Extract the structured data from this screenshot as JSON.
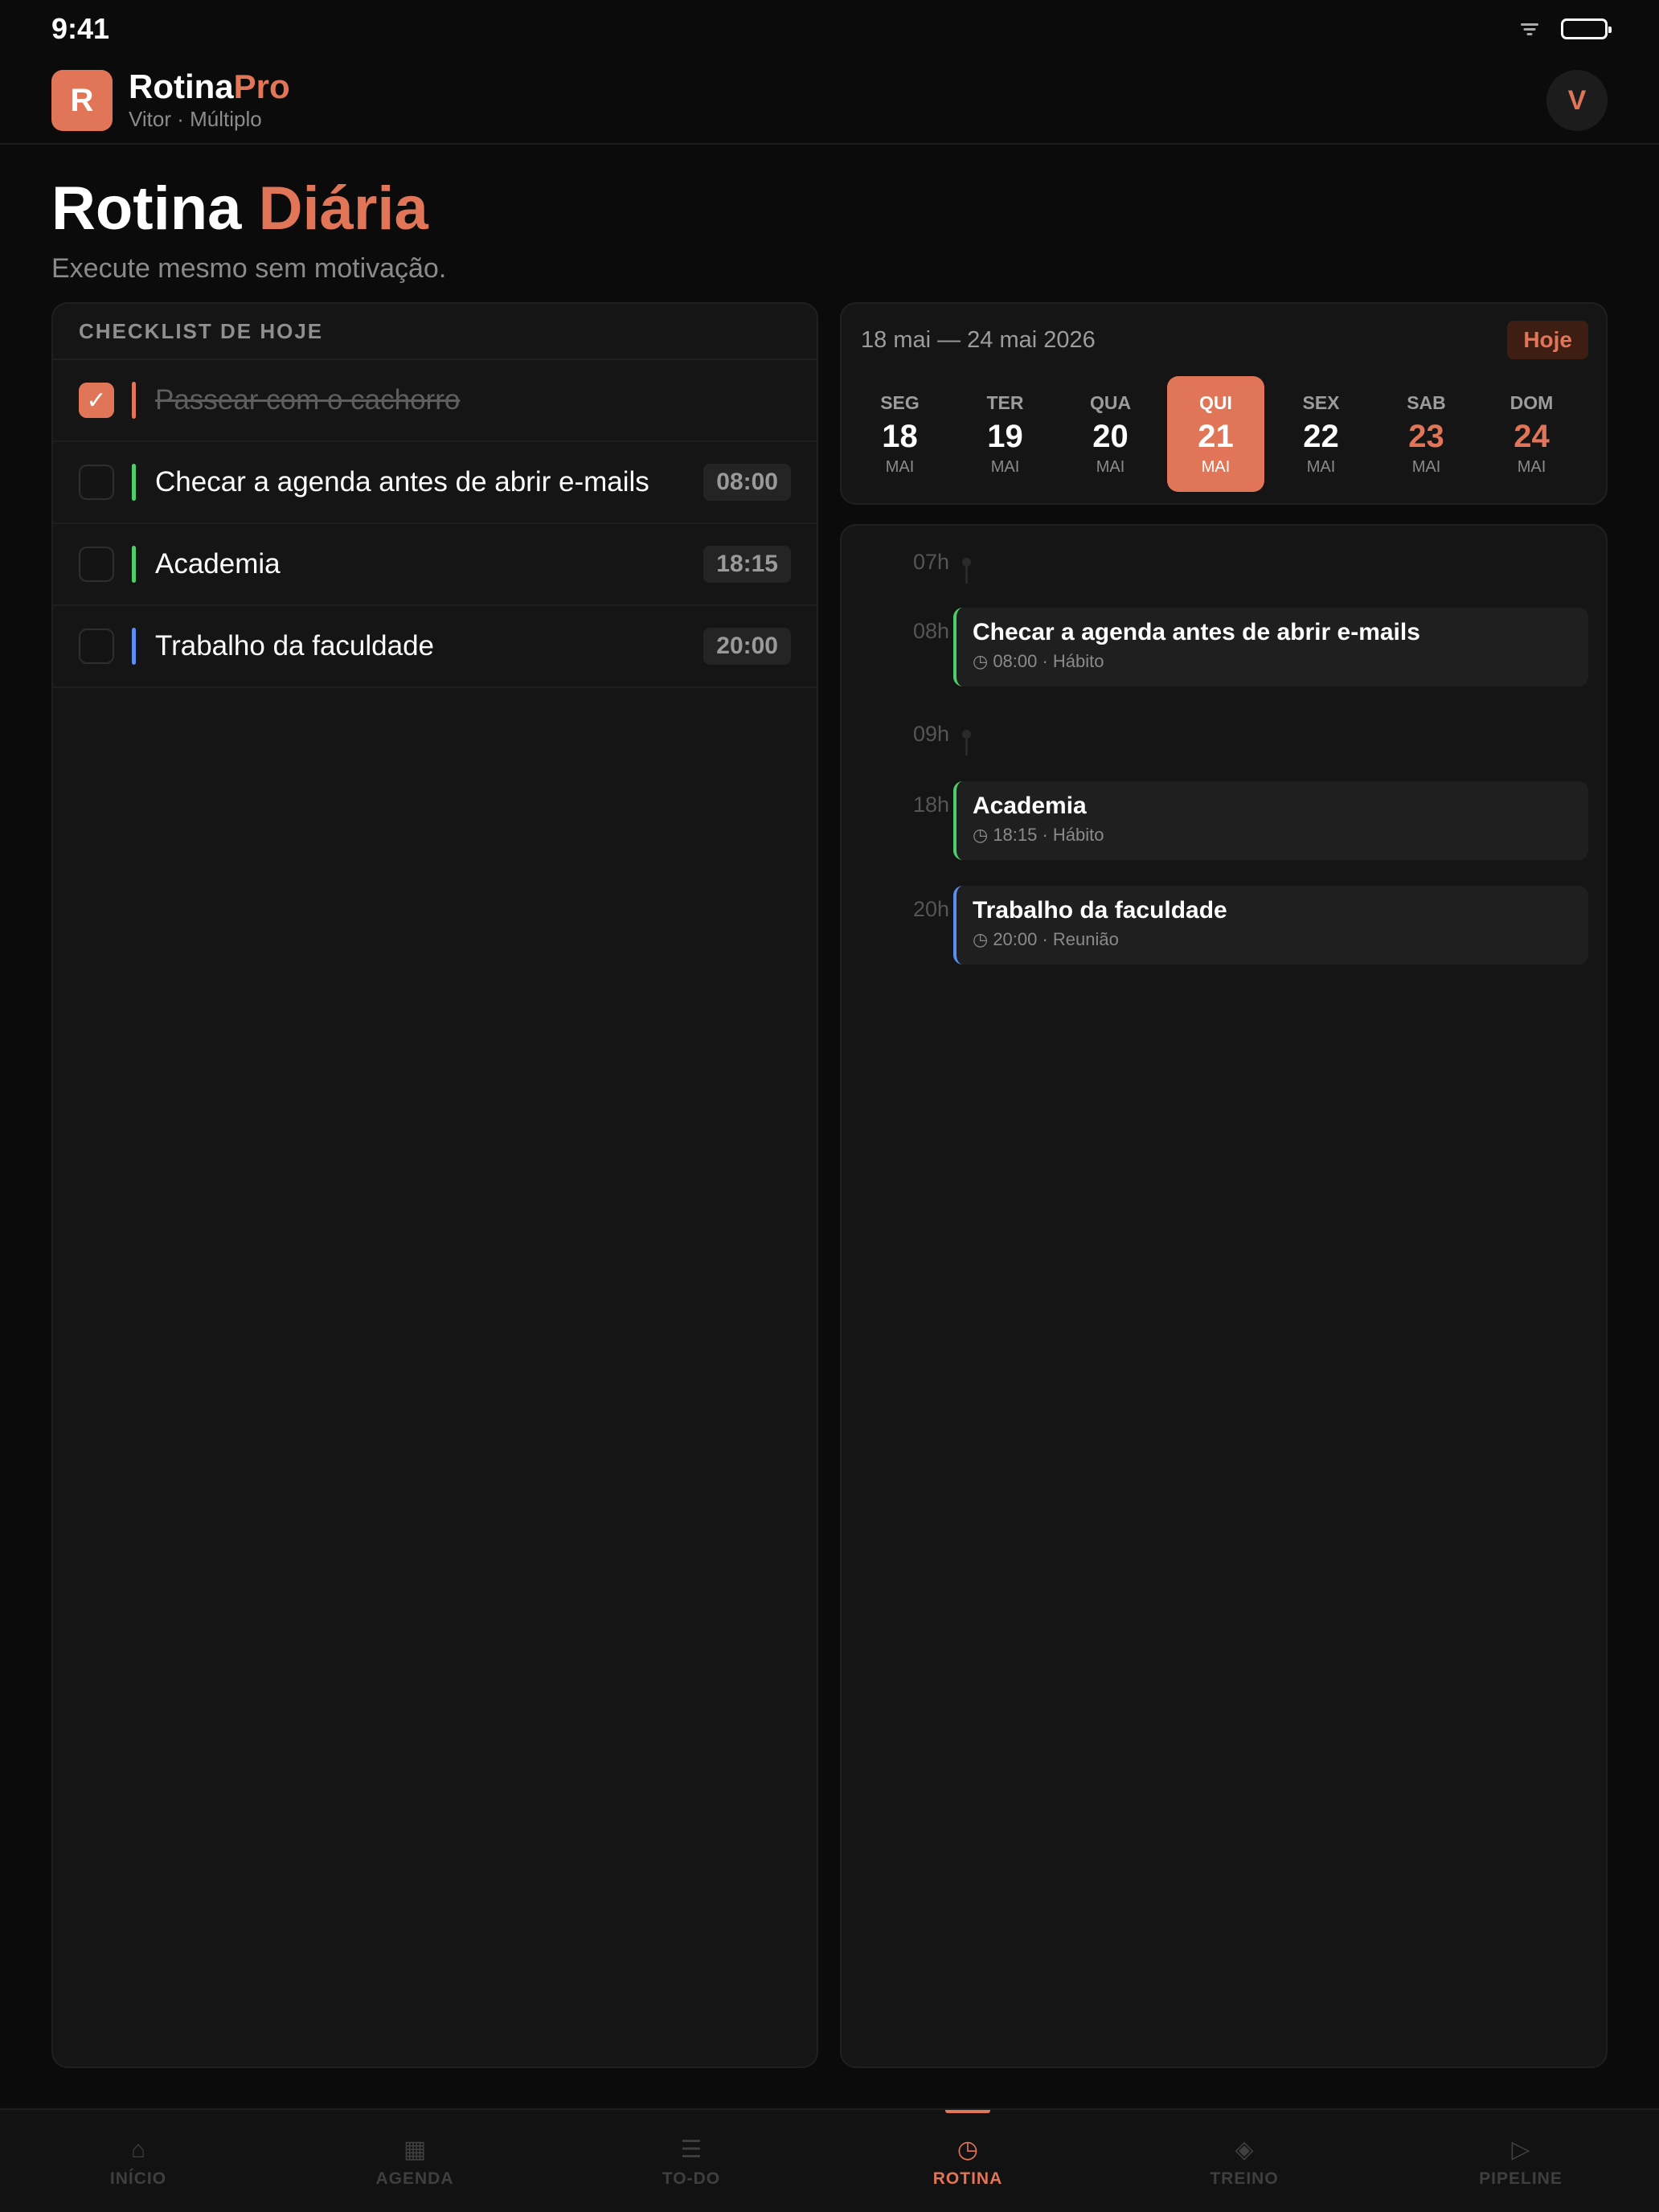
{
  "status": {
    "time": "9:41"
  },
  "header": {
    "logo_letter": "R",
    "brand_primary": "Rotina",
    "brand_accent": "Pro",
    "subtitle": "Vitor · Múltiplo",
    "avatar_letter": "V"
  },
  "page": {
    "title_main": "Rotina",
    "title_accent": "Diária",
    "subtitle": "Execute mesmo sem motivação."
  },
  "checklist": {
    "header": "CHECKLIST DE HOJE",
    "items": [
      {
        "label": "Passear com o cachorro",
        "time": "",
        "done": true,
        "color": "#e07558"
      },
      {
        "label": "Checar a agenda antes de abrir e-mails",
        "time": "08:00",
        "done": false,
        "color": "#4ccf6a"
      },
      {
        "label": "Academia",
        "time": "18:15",
        "done": false,
        "color": "#4ccf6a"
      },
      {
        "label": "Trabalho da faculdade",
        "time": "20:00",
        "done": false,
        "color": "#5b8ef0"
      }
    ]
  },
  "week": {
    "range": "18 mai — 24 mai 2026",
    "today_label": "Hoje",
    "days": [
      {
        "name": "SEG",
        "num": "18",
        "month": "MAI",
        "active": false,
        "weekend": false
      },
      {
        "name": "TER",
        "num": "19",
        "month": "MAI",
        "active": false,
        "weekend": false
      },
      {
        "name": "QUA",
        "num": "20",
        "month": "MAI",
        "active": false,
        "weekend": false
      },
      {
        "name": "QUI",
        "num": "21",
        "month": "MAI",
        "active": true,
        "weekend": false
      },
      {
        "name": "SEX",
        "num": "22",
        "month": "MAI",
        "active": false,
        "weekend": false
      },
      {
        "name": "SAB",
        "num": "23",
        "month": "MAI",
        "active": false,
        "weekend": true
      },
      {
        "name": "DOM",
        "num": "24",
        "month": "MAI",
        "active": false,
        "weekend": true
      }
    ]
  },
  "timeline": {
    "rows": [
      {
        "hour": "07h",
        "dot_color": "#2a2a2a",
        "event": null
      },
      {
        "hour": "08h",
        "dot_color": "#4ccf6a",
        "event": {
          "title": "Checar a agenda antes de abrir e-mails",
          "meta": "08:00 · Hábito",
          "color": "#4ccf6a"
        }
      },
      {
        "hour": "09h",
        "dot_color": "#2a2a2a",
        "event": null
      },
      {
        "hour": "18h",
        "dot_color": "#4ccf6a",
        "event": {
          "title": "Academia",
          "meta": "18:15 · Hábito",
          "color": "#4ccf6a"
        }
      },
      {
        "hour": "20h",
        "dot_color": "#5b8ef0",
        "event": {
          "title": "Trabalho da faculdade",
          "meta": "20:00 · Reunião",
          "color": "#5b8ef0"
        }
      }
    ]
  },
  "tabs": [
    {
      "label": "INÍCIO",
      "icon": "home-icon",
      "glyph": "⌂",
      "active": false
    },
    {
      "label": "AGENDA",
      "icon": "calendar-icon",
      "glyph": "▦",
      "active": false
    },
    {
      "label": "TO-DO",
      "icon": "list-icon",
      "glyph": "☰",
      "active": false
    },
    {
      "label": "ROTINA",
      "icon": "clock-icon",
      "glyph": "◷",
      "active": true
    },
    {
      "label": "TREINO",
      "icon": "diamond-icon",
      "glyph": "◈",
      "active": false
    },
    {
      "label": "PIPELINE",
      "icon": "play-icon",
      "glyph": "▷",
      "active": false
    }
  ]
}
